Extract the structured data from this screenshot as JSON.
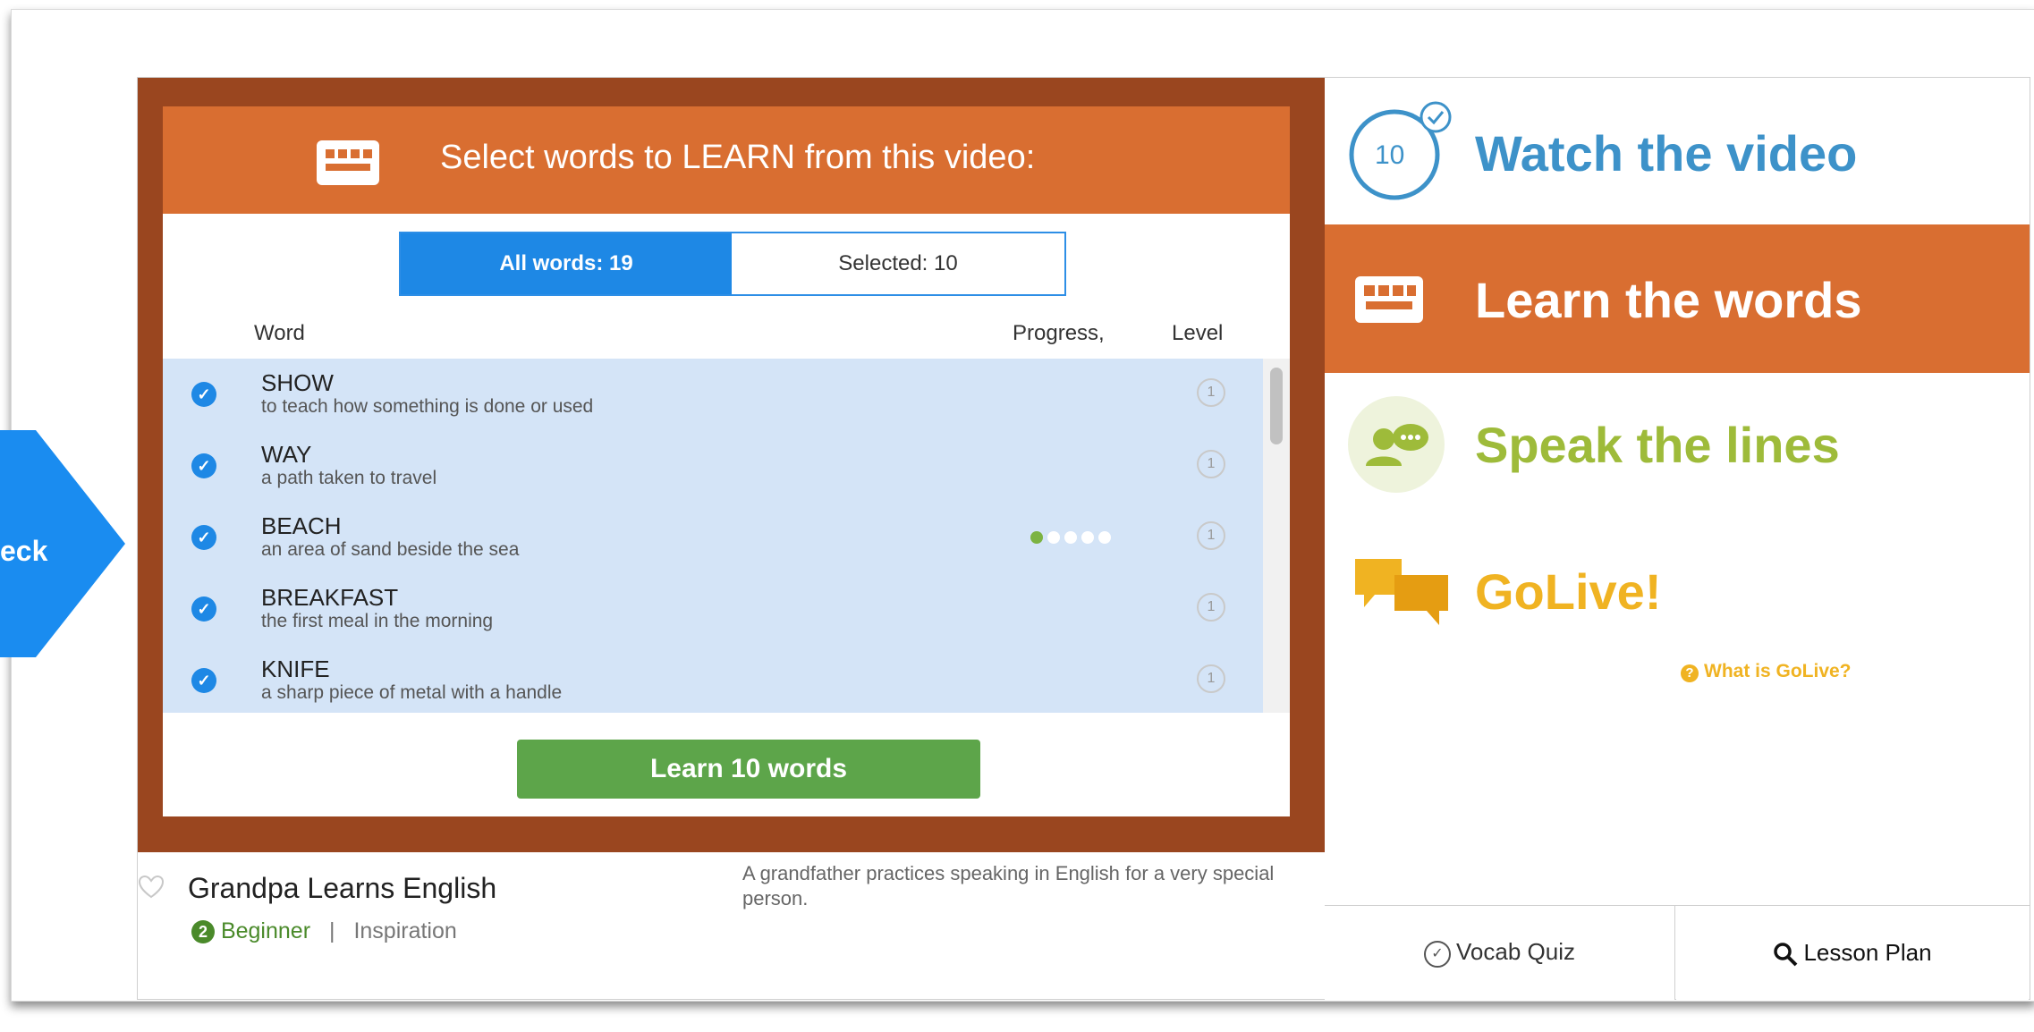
{
  "side_tab": {
    "label": "eck"
  },
  "panel": {
    "title": "Select words to LEARN from this video:",
    "tabs": {
      "all": "All words: 19",
      "selected": "Selected: 10"
    },
    "columns": {
      "word": "Word",
      "progress": "Progress,",
      "level": "Level"
    },
    "words": [
      {
        "word": "SHOW",
        "definition": "to teach how something is done or used",
        "level": "1",
        "selected": true,
        "progress": 0
      },
      {
        "word": "WAY",
        "definition": "a path taken to travel",
        "level": "1",
        "selected": true,
        "progress": 0
      },
      {
        "word": "BEACH",
        "definition": "an area of sand beside the sea",
        "level": "1",
        "selected": true,
        "progress": 1
      },
      {
        "word": "BREAKFAST",
        "definition": "the first meal in the morning",
        "level": "1",
        "selected": true,
        "progress": 0
      },
      {
        "word": "KNIFE",
        "definition": "a sharp piece of metal with a handle",
        "level": "1",
        "selected": true,
        "progress": 0
      }
    ],
    "learn_button": "Learn 10 words"
  },
  "video": {
    "title": "Grandpa Learns English",
    "level_number": "2",
    "level": "Beginner",
    "separator": "|",
    "category": "Inspiration",
    "description": "A grandfather practices speaking in English for a very special person."
  },
  "steps": {
    "watch": {
      "badge": "10",
      "label": "Watch the video"
    },
    "learn": {
      "label": "Learn the words"
    },
    "speak": {
      "label": "Speak the lines"
    },
    "golive": {
      "label": "GoLive!",
      "link": "What is GoLive?"
    }
  },
  "bottom": {
    "quiz": "Vocab Quiz",
    "plan": "Lesson Plan"
  },
  "colors": {
    "orange": "#d96e31",
    "brown": "#9a461f",
    "blue": "#1e88e5",
    "green": "#5da54a",
    "lime": "#9ebb3a",
    "gold": "#f0b322",
    "watch_blue": "#3d92c9"
  }
}
